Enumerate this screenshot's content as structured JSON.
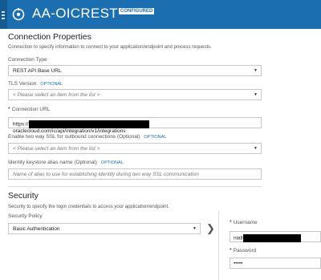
{
  "app": {
    "title": "AA-OICREST",
    "status_badge": "CONFIGURED",
    "logo": "connection-logo-icon"
  },
  "connection": {
    "title": "Connection Properties",
    "description": "Connection to specify information to connect to your application/endpoint and process requests.",
    "connection_type": {
      "label": "Connection Type",
      "value": "REST API Base URL"
    },
    "tls_version": {
      "label": "TLS Version",
      "optional": "OPTIONAL",
      "placeholder": "< Please select an item from the list >"
    },
    "connection_url": {
      "label": "Connection URL",
      "prefix": "https://",
      "suffix": "oraclecloud.com/ic/api/integration/v1/integrations"
    },
    "two_way_ssl": {
      "label": "Enable two way SSL for outbound connections (Optional)",
      "optional": "OPTIONAL",
      "placeholder": "< Please select an item from the list >"
    },
    "identity_alias": {
      "label": "Identity keystore alias name (Optional)",
      "optional": "OPTIONAL",
      "placeholder": "Name of alias to use for establishing identity during two way SSL communication"
    }
  },
  "security": {
    "title": "Security",
    "description": "Security to specify the login credentials to access your application/endpoint.",
    "policy": {
      "label": "Security Policy",
      "value": "Basic Authentication"
    },
    "username": {
      "label": "Username",
      "value": "niall"
    },
    "password": {
      "label": "Password",
      "value": "•••••"
    }
  },
  "colors": {
    "header": "#1b6fb0",
    "accent": "#1b6fb0"
  }
}
